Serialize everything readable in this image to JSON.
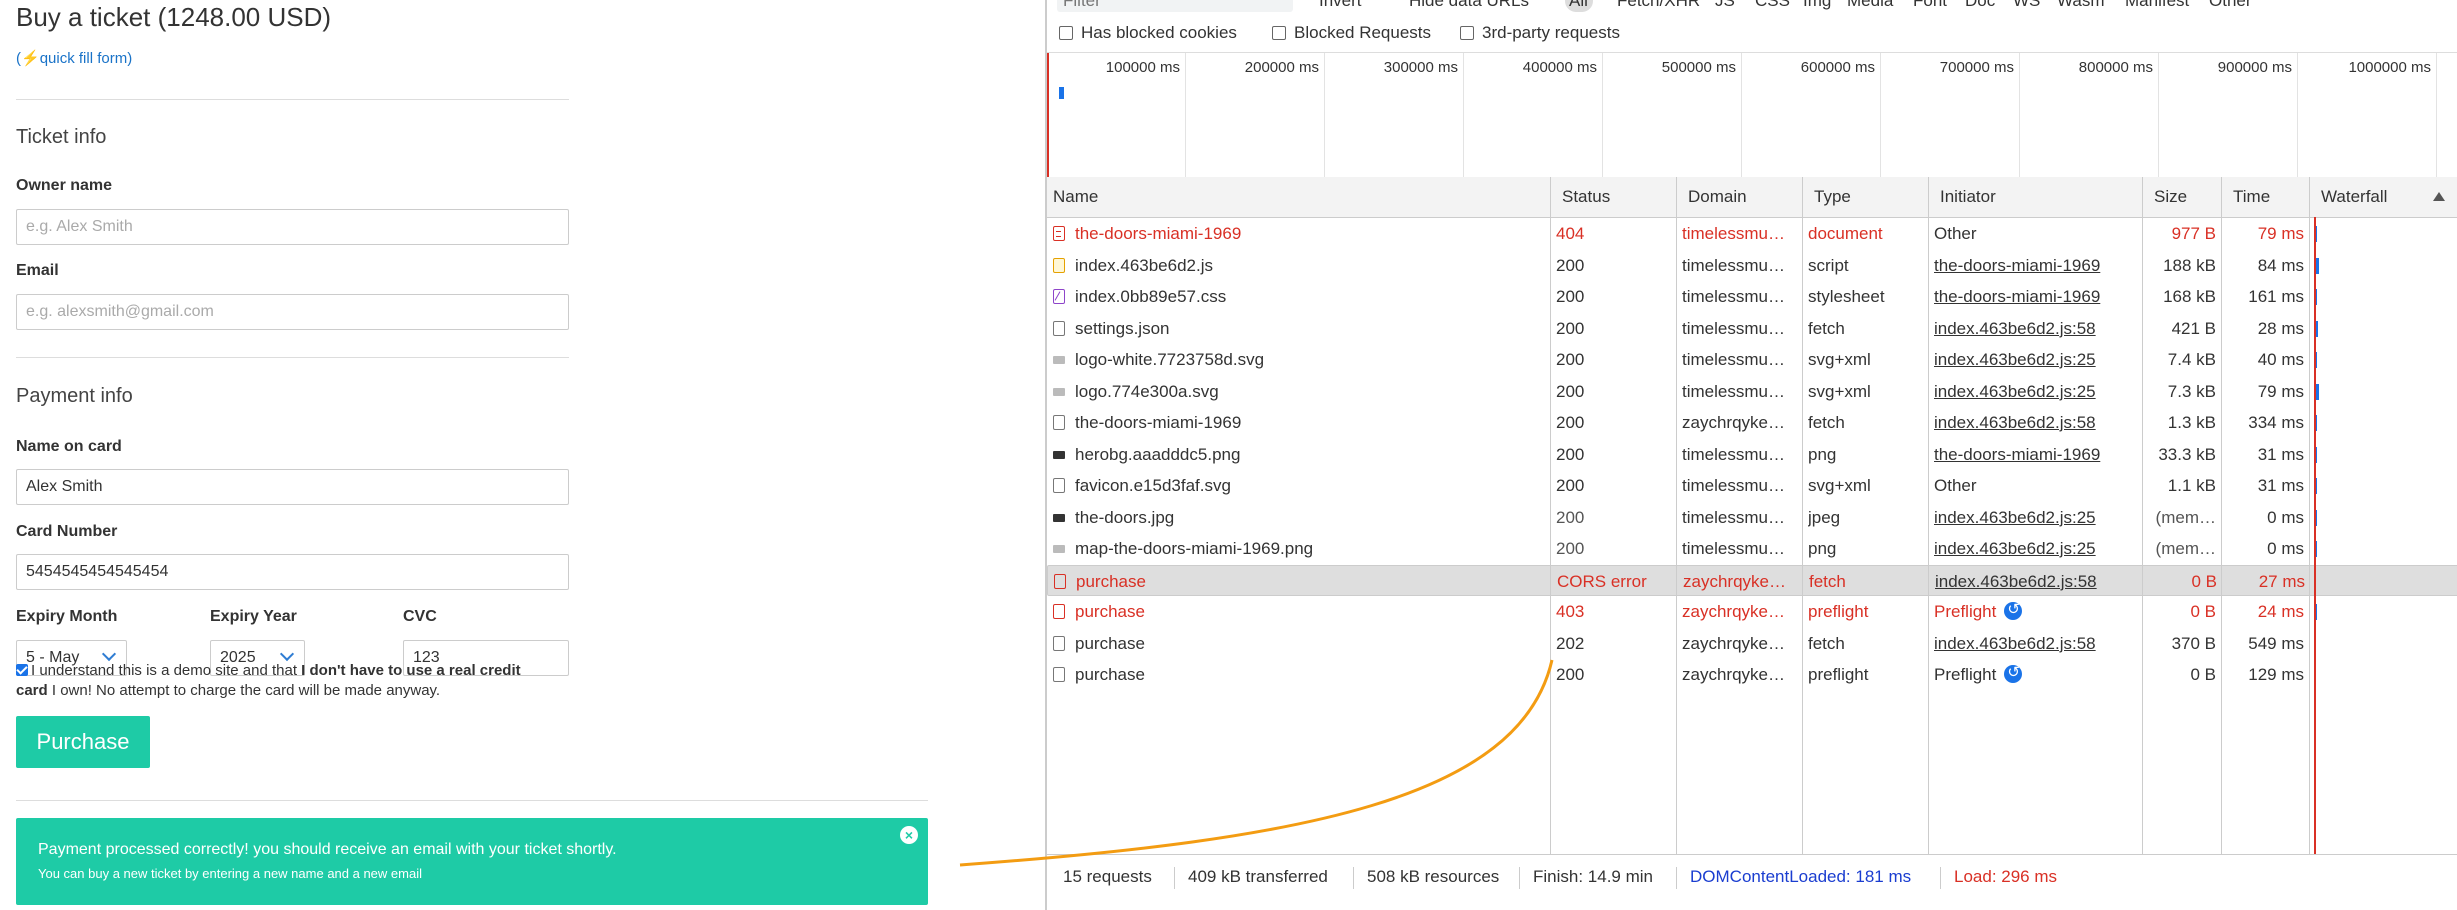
{
  "checkout": {
    "title": "Buy a ticket (1248.00 USD)",
    "quickfill_open": "(",
    "quickfill_bolt": "⚡",
    "quickfill_link": "quick fill form",
    "quickfill_close": ")",
    "ticket_section": "Ticket info",
    "owner_label": "Owner name",
    "owner_placeholder": "e.g. Alex Smith",
    "email_label": "Email",
    "email_placeholder": "e.g. alexsmith@gmail.com",
    "payment_section": "Payment info",
    "name_on_card_label": "Name on card",
    "name_on_card_value": "Alex Smith",
    "card_number_label": "Card Number",
    "card_number_value": "5454545454545454",
    "expiry_month_label": "Expiry Month",
    "expiry_month_value": "5 - May",
    "expiry_year_label": "Expiry Year",
    "expiry_year_value": "2025",
    "cvc_label": "CVC",
    "cvc_value": "123",
    "consent_a": "I understand this is a demo site and that ",
    "consent_b": "I don't have to use a real credit card",
    "consent_c": " I own! No attempt to charge the card will be made anyway.",
    "purchase_button": "Purchase",
    "notification_line1": "Payment processed correctly! you should receive an email with your ticket shortly.",
    "notification_line2": "You can buy a new ticket by entering a new name and a new email",
    "notification_close": "×"
  },
  "devtools": {
    "filter_placeholder": "Filter",
    "filter_types": [
      "Invert",
      "Hide data URLs",
      "All",
      "Fetch/XHR",
      "JS",
      "CSS",
      "Img",
      "Media",
      "Font",
      "Doc",
      "WS",
      "Wasm",
      "Manifest",
      "Other"
    ],
    "checkbox_filters": [
      "Has blocked cookies",
      "Blocked Requests",
      "3rd-party requests"
    ],
    "timeline_ticks": [
      "100000 ms",
      "200000 ms",
      "300000 ms",
      "400000 ms",
      "500000 ms",
      "600000 ms",
      "700000 ms",
      "800000 ms",
      "900000 ms",
      "1000000 ms"
    ],
    "columns": [
      "Name",
      "Status",
      "Domain",
      "Type",
      "Initiator",
      "Size",
      "Time",
      "Waterfall"
    ],
    "rows": [
      {
        "name": "the-doors-miami-1969",
        "status": "404",
        "domain": "timelessmu…",
        "type": "document",
        "initiator": "Other",
        "size": "977 B",
        "time": "79 ms",
        "icon": "doc",
        "error": true
      },
      {
        "name": "index.463be6d2.js",
        "status": "200",
        "domain": "timelessmu…",
        "type": "script",
        "initiator": "the-doors-miami-1969",
        "size": "188 kB",
        "time": "84 ms",
        "icon": "js"
      },
      {
        "name": "index.0bb89e57.css",
        "status": "200",
        "domain": "timelessmu…",
        "type": "stylesheet",
        "initiator": "the-doors-miami-1969",
        "size": "168 kB",
        "time": "161 ms",
        "icon": "css"
      },
      {
        "name": "settings.json",
        "status": "200",
        "domain": "timelessmu…",
        "type": "fetch",
        "initiator": "index.463be6d2.js:58",
        "size": "421 B",
        "time": "28 ms",
        "icon": "file"
      },
      {
        "name": "logo-white.7723758d.svg",
        "status": "200",
        "domain": "timelessmu…",
        "type": "svg+xml",
        "initiator": "index.463be6d2.js:25",
        "size": "7.4 kB",
        "time": "40 ms",
        "icon": "img"
      },
      {
        "name": "logo.774e300a.svg",
        "status": "200",
        "domain": "timelessmu…",
        "type": "svg+xml",
        "initiator": "index.463be6d2.js:25",
        "size": "7.3 kB",
        "time": "79 ms",
        "icon": "img"
      },
      {
        "name": "the-doors-miami-1969",
        "status": "200",
        "domain": "zaychrqyke…",
        "type": "fetch",
        "initiator": "index.463be6d2.js:58",
        "size": "1.3 kB",
        "time": "334 ms",
        "icon": "file"
      },
      {
        "name": "herobg.aaadddc5.png",
        "status": "200",
        "domain": "timelessmu…",
        "type": "png",
        "initiator": "the-doors-miami-1969",
        "size": "33.3 kB",
        "time": "31 ms",
        "icon": "imgdark"
      },
      {
        "name": "favicon.e15d3faf.svg",
        "status": "200",
        "domain": "timelessmu…",
        "type": "svg+xml",
        "initiator": "Other",
        "size": "1.1 kB",
        "time": "31 ms",
        "icon": "file"
      },
      {
        "name": "the-doors.jpg",
        "status": "200",
        "domain": "timelessmu…",
        "type": "jpeg",
        "initiator": "index.463be6d2.js:25",
        "size": "(mem…",
        "time": "0 ms",
        "icon": "imgdark",
        "cached": true
      },
      {
        "name": "map-the-doors-miami-1969.png",
        "status": "200",
        "domain": "timelessmu…",
        "type": "png",
        "initiator": "index.463be6d2.js:25",
        "size": "(mem…",
        "time": "0 ms",
        "icon": "img",
        "cached": true
      },
      {
        "name": "purchase",
        "status": "CORS error",
        "domain": "zaychrqyke…",
        "type": "fetch",
        "initiator": "index.463be6d2.js:58",
        "size": "0 B",
        "time": "27 ms",
        "icon": "red",
        "error": true,
        "selected": true
      },
      {
        "name": "purchase",
        "status": "403",
        "domain": "zaychrqyke…",
        "type": "preflight",
        "initiator": "Preflight",
        "size": "0 B",
        "time": "24 ms",
        "icon": "red",
        "error": true,
        "preflight": true
      },
      {
        "name": "purchase",
        "status": "202",
        "domain": "zaychrqyke…",
        "type": "fetch",
        "initiator": "index.463be6d2.js:58",
        "size": "370 B",
        "time": "549 ms",
        "icon": "file"
      },
      {
        "name": "purchase",
        "status": "200",
        "domain": "zaychrqyke…",
        "type": "preflight",
        "initiator": "Preflight",
        "size": "0 B",
        "time": "129 ms",
        "icon": "file",
        "preflight": true
      }
    ],
    "status_bar": {
      "requests": "15 requests",
      "transferred": "409 kB transferred",
      "resources": "508 kB resources",
      "finish": "Finish: 14.9 min",
      "dcl": "DOMContentLoaded: 181 ms",
      "load": "Load: 296 ms"
    },
    "colors": {
      "error": "#d93025",
      "link_blue": "#1a3dd0",
      "accent": "#1ecba6",
      "annotation_arrow": "#f39c12"
    }
  }
}
